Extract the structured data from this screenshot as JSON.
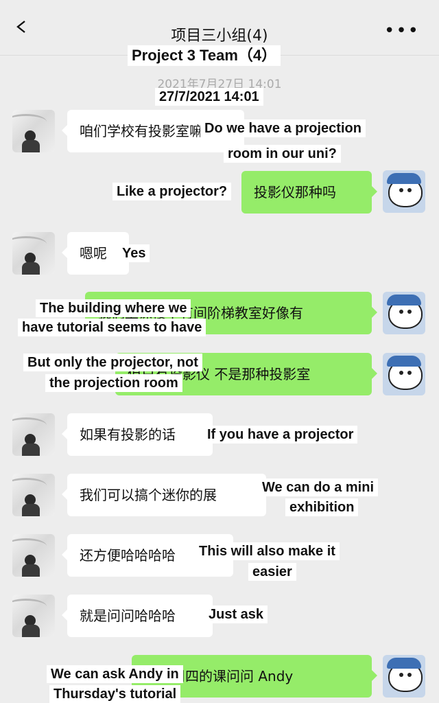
{
  "header": {
    "title": "项目三小组(4)",
    "back_icon": "chevron-left-icon",
    "more_icon": "more-dots-icon",
    "title_caption": "Project 3 Team（4）"
  },
  "timestamp": {
    "text": "2021年7月27日 14:01",
    "caption": "27/7/2021 14:01"
  },
  "messages": [
    {
      "side": "left",
      "text": "咱们学校有投影室嘛",
      "caption": [
        "Do we have a projection",
        "room in our uni?"
      ]
    },
    {
      "side": "right",
      "text": "投影仪那种吗",
      "caption": [
        "Like a projector?"
      ]
    },
    {
      "side": "left",
      "text": "嗯呢",
      "caption": [
        "Yes"
      ]
    },
    {
      "side": "right",
      "text": "我们上课楼下有间阶梯教室好像有",
      "caption": [
        "The building where we",
        "have tutorial seems to have"
      ]
    },
    {
      "side": "right",
      "text": "但只有投影仪 不是那种投影室",
      "caption": [
        "But only the projector, not",
        "the projection room"
      ]
    },
    {
      "side": "left",
      "text": "如果有投影的话",
      "caption": [
        "If you have a projector"
      ]
    },
    {
      "side": "left",
      "text": "我们可以搞个迷你的展",
      "caption": [
        "We can do a mini",
        "exhibition"
      ]
    },
    {
      "side": "left",
      "text": "还方便哈哈哈哈",
      "caption": [
        "This will also make it",
        "easier"
      ]
    },
    {
      "side": "left",
      "text": "就是问问哈哈哈",
      "caption": [
        "Just ask"
      ]
    },
    {
      "side": "right",
      "text": "可以周四的课问问 Andy",
      "caption": [
        "We can ask Andy in",
        "Thursday's tutorial"
      ]
    }
  ],
  "colors": {
    "background": "#ededed",
    "bubble_left": "#ffffff",
    "bubble_right": "#95ec69"
  }
}
